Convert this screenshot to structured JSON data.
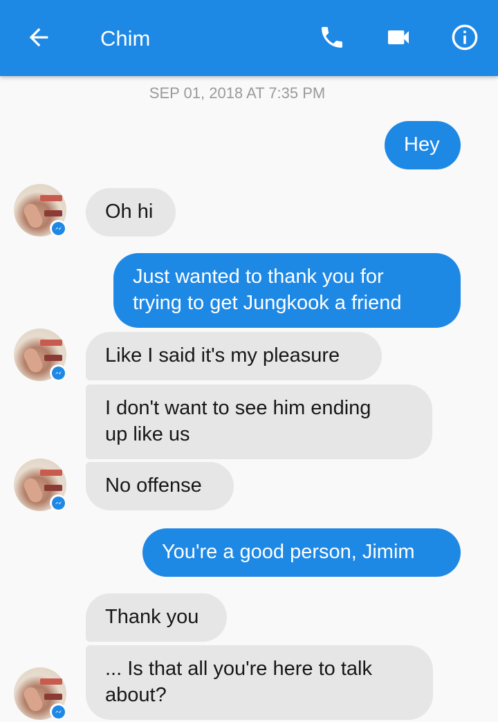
{
  "header": {
    "title": "Chim",
    "back_icon": "back-arrow-icon",
    "call_icon": "phone-icon",
    "video_icon": "video-camera-icon",
    "info_icon": "info-icon",
    "accent_color": "#1e88e5"
  },
  "timestamp": "SEP 01, 2018 AT 7:35 PM",
  "messages": [
    {
      "from": "me",
      "lines": [
        "Hey"
      ]
    },
    {
      "from": "them",
      "lines": [
        "Oh hi"
      ]
    },
    {
      "from": "me",
      "lines": [
        "Just wanted to thank you for",
        "trying to get Jungkook a friend"
      ]
    },
    {
      "from": "them",
      "lines": [
        "Like I said it's my pleasure"
      ]
    },
    {
      "from": "them",
      "lines": [
        "I don't want to see him ending",
        "up like us"
      ]
    },
    {
      "from": "them",
      "lines": [
        "No offense"
      ]
    },
    {
      "from": "me",
      "lines": [
        "You're a good person, Jimim"
      ]
    },
    {
      "from": "them",
      "lines": [
        "Thank you"
      ]
    },
    {
      "from": "them",
      "lines": [
        "... Is that all you're here to talk",
        "about?"
      ]
    }
  ]
}
